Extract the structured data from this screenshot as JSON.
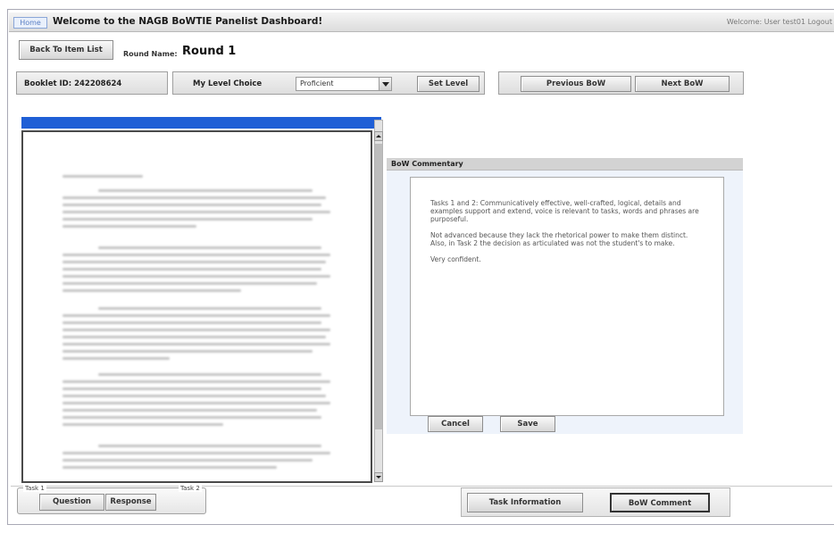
{
  "header": {
    "home_label": "Home",
    "title": "Welcome to the NAGB BoWTIE Panelist Dashboard!",
    "welcome_text": "Welcome: User test01 Logout"
  },
  "toolbar": {
    "back_label": "Back To Item List",
    "round_label": "Round Name:",
    "round_value": "Round 1"
  },
  "controls": {
    "booklet_id": "Booklet ID: 242208624",
    "level_label": "My Level Choice",
    "level_value": "Proficient",
    "set_level_label": "Set Level",
    "previous_label": "Previous BoW",
    "next_label": "Next BoW"
  },
  "commentary": {
    "title": "BoW Commentary",
    "paragraphs": [
      "Tasks 1 and 2: Communicatively effective, well-crafted, logical, details and examples support and extend, voice is relevant to tasks, words and phrases are purposeful.",
      "Not advanced because they lack the rhetorical power to make them distinct. Also, in Task 2 the decision as articulated was not the student's to make.",
      "Very confident."
    ],
    "cancel_label": "Cancel",
    "save_label": "Save"
  },
  "bottom": {
    "task1_label": "Task 1",
    "task2_label": "Task 2",
    "question_label": "Question",
    "response_label": "Response",
    "task_info_label": "Task Information",
    "bow_comment_label": "BoW Comment"
  },
  "colors": {
    "viewer_header": "#1f5fd6",
    "commentary_background": "#eef3fb"
  }
}
